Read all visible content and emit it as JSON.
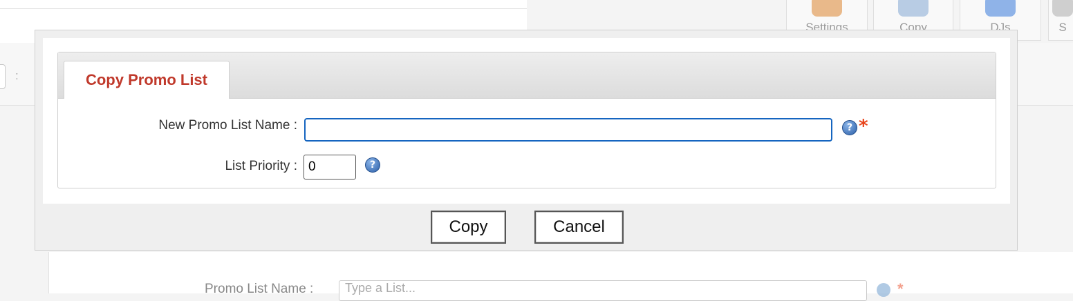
{
  "background": {
    "toolbar_buttons": [
      {
        "label": "Settings",
        "icon": "settings-icon",
        "color": "#e9b98a"
      },
      {
        "label": "Copy",
        "icon": "copy-icon",
        "color": "#b8cce4"
      },
      {
        "label": "DJs",
        "icon": "djs-icon",
        "color": "#8fb3e8"
      },
      {
        "label": "S",
        "icon": "more-icon",
        "color": "#cfcfcf"
      }
    ],
    "form_label": "Promo List Name :",
    "form_placeholder": "Type a List..."
  },
  "dialog": {
    "tab_title": "Copy Promo List",
    "fields": {
      "name": {
        "label": "New Promo List Name :",
        "value": "",
        "required": true,
        "required_mark": "*"
      },
      "priority": {
        "label": "List Priority :",
        "value": "0"
      }
    },
    "help_icon_glyph": "?",
    "buttons": {
      "copy": "Copy",
      "cancel": "Cancel"
    }
  },
  "colors": {
    "tab_title": "#c0392b",
    "focus_border": "#1565c0",
    "required": "#e8431a"
  }
}
